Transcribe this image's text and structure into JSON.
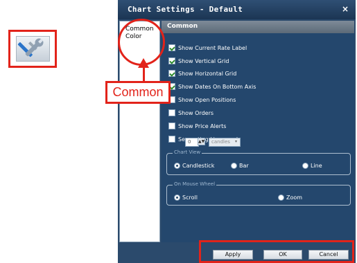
{
  "dialog": {
    "title": "Chart Settings - Default",
    "close_glyph": "×"
  },
  "nav": {
    "items": [
      "Common",
      "Color"
    ]
  },
  "section": {
    "title": "Common"
  },
  "checkboxes": [
    {
      "label": "Show Current Rate Label",
      "checked": true
    },
    {
      "label": "Show Vertical Grid",
      "checked": true
    },
    {
      "label": "Show Horizontal Grid",
      "checked": true
    },
    {
      "label": "Show Dates On Bottom Axis",
      "checked": true
    },
    {
      "label": "Show Open Positions",
      "checked": false
    },
    {
      "label": "Show Orders",
      "checked": false
    },
    {
      "label": "Show Price Alerts",
      "checked": false
    },
    {
      "label": "Separating Lines each",
      "checked": false
    }
  ],
  "separating": {
    "value": "0",
    "spin_glyph": "▲▼",
    "unit": "candles",
    "dropdown_glyph": "▾"
  },
  "chart_view": {
    "title": "Chart View",
    "options": [
      {
        "label": "Candlestick",
        "selected": true
      },
      {
        "label": "Bar",
        "selected": false
      },
      {
        "label": "Line",
        "selected": false
      }
    ]
  },
  "mouse_wheel": {
    "title": "On Mouse Wheel",
    "options": [
      {
        "label": "Scroll",
        "selected": true
      },
      {
        "label": "Zoom",
        "selected": false
      }
    ]
  },
  "buttons": {
    "apply": "Apply",
    "ok": "OK",
    "cancel": "Cancel"
  },
  "annotations": {
    "common_label": "Common"
  },
  "colors": {
    "annotation_red": "#e2231a",
    "dialog_bg": "#24476d",
    "check_green": "#2e8b2e"
  }
}
